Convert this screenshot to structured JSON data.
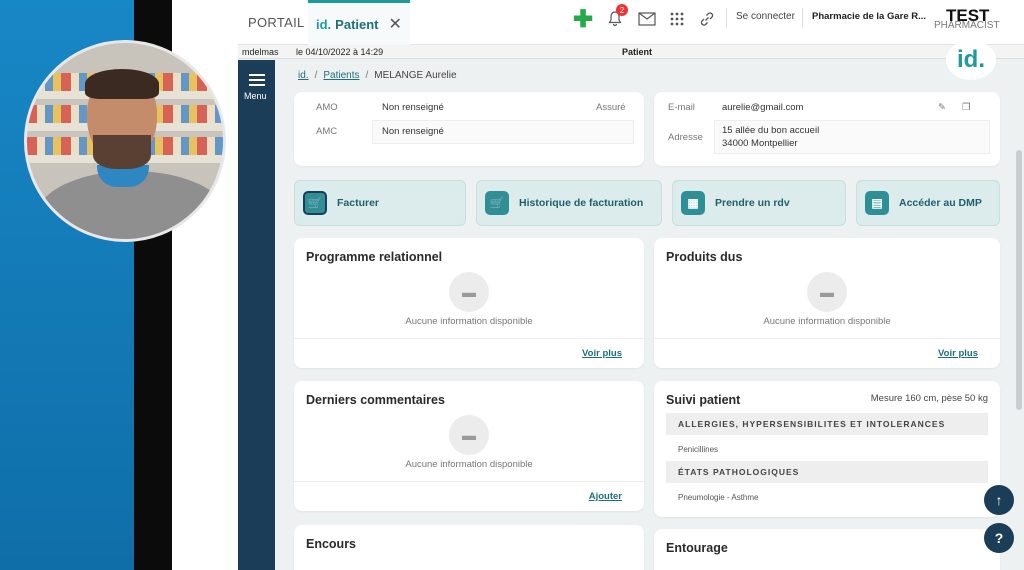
{
  "tabs": {
    "portail": "PORTAIL",
    "patient_logo": "id.",
    "patient_label": "Patient",
    "close_glyph": "✕"
  },
  "toolbar": {
    "notification_count": "2",
    "connect_label": "Se connecter",
    "pharmacy_name": "Pharmacie de la Gare R...",
    "test_label": "TEST",
    "pharmacist_label": "PHARMACIST"
  },
  "subbar": {
    "user": "mdelmas",
    "datetime": "le 04/10/2022 à 14:29",
    "context": "Patient"
  },
  "sidebar": {
    "menu_label": "Menu"
  },
  "brand": {
    "logo": "id."
  },
  "breadcrumb": {
    "home": "id.",
    "patients": "Patients",
    "current": "MELANGE Aurelie"
  },
  "info": {
    "amo_label": "AMO",
    "amo_value": "Non renseigné",
    "assure_label": "Assuré",
    "amc_label": "AMC",
    "amc_value": "Non renseigné",
    "email_label": "E-mail",
    "email_value": "aurelie@gmail.com",
    "adresse_label": "Adresse",
    "adresse_line1": "15 allée du bon accueil",
    "adresse_line2": "34000 Montpellier"
  },
  "actions": {
    "facturer": "Facturer",
    "historique": "Historique de facturation",
    "rdv": "Prendre un rdv",
    "dmp": "Accéder au DMP"
  },
  "panels": {
    "programme_title": "Programme relationnel",
    "produits_title": "Produits dus",
    "commentaires_title": "Derniers commentaires",
    "suivi_title": "Suivi patient",
    "encours_title": "Encours",
    "entourage_title": "Entourage",
    "empty_text": "Aucune information disponible",
    "voir_plus": "Voir plus",
    "ajouter": "Ajouter",
    "suivi_measure": "Mesure 160 cm, pèse 50 kg",
    "allergies_header": "ALLERGIES, HYPERSENSIBILITES ET INTOLERANCES",
    "allergies_item": "Penicillines",
    "etats_header": "ÉTATS PATHOLOGIQUES",
    "etats_item": "Pneumologie - Asthme"
  },
  "floating": {
    "top": "↑",
    "help": "?"
  },
  "colors": {
    "accent": "#1f9a9a",
    "sidebar": "#1c3d57",
    "action_bg": "#dcecec"
  }
}
